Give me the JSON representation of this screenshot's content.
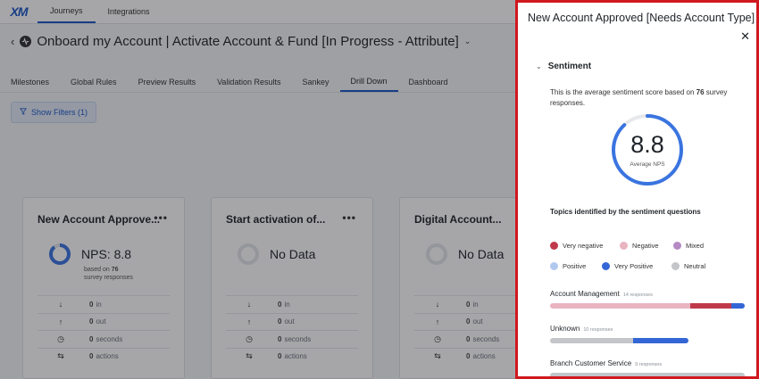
{
  "app": {
    "logo": "XM",
    "nav": [
      {
        "label": "Journeys",
        "active": true
      },
      {
        "label": "Integrations",
        "active": false
      }
    ],
    "page_title": "Onboard my Account | Activate Account & Fund [In Progress - Attribute]",
    "tabs": [
      {
        "label": "Milestones",
        "active": false
      },
      {
        "label": "Global Rules",
        "active": false
      },
      {
        "label": "Preview Results",
        "active": false
      },
      {
        "label": "Validation Results",
        "active": false
      },
      {
        "label": "Sankey",
        "active": false
      },
      {
        "label": "Drill Down",
        "active": true
      },
      {
        "label": "Dashboard",
        "active": false
      }
    ],
    "filter_button": "Show Filters (1)"
  },
  "cards": [
    {
      "title": "New Account Approve...",
      "menu": "•••",
      "metric": "NPS: 8.8",
      "has_score": true,
      "sub_prefix": "based on ",
      "sub_count": "76",
      "sub_suffix": "survey responses",
      "stats": [
        {
          "icon": "arrow-down-icon",
          "glyph": "↓",
          "value": "0",
          "unit": "in"
        },
        {
          "icon": "arrow-up-icon",
          "glyph": "↑",
          "value": "0",
          "unit": "out"
        },
        {
          "icon": "clock-icon",
          "glyph": "◷",
          "value": "0",
          "unit": "seconds"
        },
        {
          "icon": "swap-icon",
          "glyph": "⇆",
          "value": "0",
          "unit": "actions"
        }
      ]
    },
    {
      "title": "Start activation of...",
      "menu": "•••",
      "metric": "No Data",
      "has_score": false,
      "stats": [
        {
          "icon": "arrow-down-icon",
          "glyph": "↓",
          "value": "0",
          "unit": "in"
        },
        {
          "icon": "arrow-up-icon",
          "glyph": "↑",
          "value": "0",
          "unit": "out"
        },
        {
          "icon": "clock-icon",
          "glyph": "◷",
          "value": "0",
          "unit": "seconds"
        },
        {
          "icon": "swap-icon",
          "glyph": "⇆",
          "value": "0",
          "unit": "actions"
        }
      ]
    },
    {
      "title": "Digital Account...",
      "menu": "",
      "metric": "No Data",
      "has_score": false,
      "stats": [
        {
          "icon": "arrow-down-icon",
          "glyph": "↓",
          "value": "0",
          "unit": "in"
        },
        {
          "icon": "arrow-up-icon",
          "glyph": "↑",
          "value": "0",
          "unit": "out"
        },
        {
          "icon": "clock-icon",
          "glyph": "◷",
          "value": "0",
          "unit": "seconds"
        },
        {
          "icon": "swap-icon",
          "glyph": "⇆",
          "value": "0",
          "unit": "actions"
        }
      ]
    }
  ],
  "panel": {
    "title": "New Account Approved [Needs Account Type]",
    "section": "Sentiment",
    "desc_prefix": "This is the average sentiment score based on ",
    "desc_count": "76",
    "desc_suffix": " survey responses.",
    "score": "8.8",
    "score_label": "Average NPS",
    "score_fraction": 0.88,
    "topics_title": "Topics identified by the sentiment questions",
    "legend": [
      {
        "label": "Very negative",
        "color": "#c0394b"
      },
      {
        "label": "Negative",
        "color": "#e9b4c0"
      },
      {
        "label": "Mixed",
        "color": "#b58ac4"
      },
      {
        "label": "Positive",
        "color": "#b3c8ef"
      },
      {
        "label": "Very Positive",
        "color": "#3466d6"
      },
      {
        "label": "Neutral",
        "color": "#c3c5c8"
      }
    ],
    "topics": [
      {
        "name": "Account Management",
        "count": "14 responses",
        "segments": [
          {
            "color": "#e9b4c0",
            "value": 72
          },
          {
            "color": "#c0394b",
            "value": 21
          },
          {
            "color": "#3466d6",
            "value": 7
          }
        ]
      },
      {
        "name": "Unknown",
        "count": "10 responses",
        "scale": 0.71,
        "segments": [
          {
            "color": "#c3c5c8",
            "value": 60
          },
          {
            "color": "#3466d6",
            "value": 40
          }
        ]
      },
      {
        "name": "Branch Customer Service",
        "count": "9 responses",
        "segments": [
          {
            "color": "#c3c5c8",
            "value": 100
          }
        ]
      }
    ]
  },
  "colors": {
    "accent": "#1c58c6",
    "panel_border": "#d0181f",
    "gauge": "#3a74e0"
  }
}
